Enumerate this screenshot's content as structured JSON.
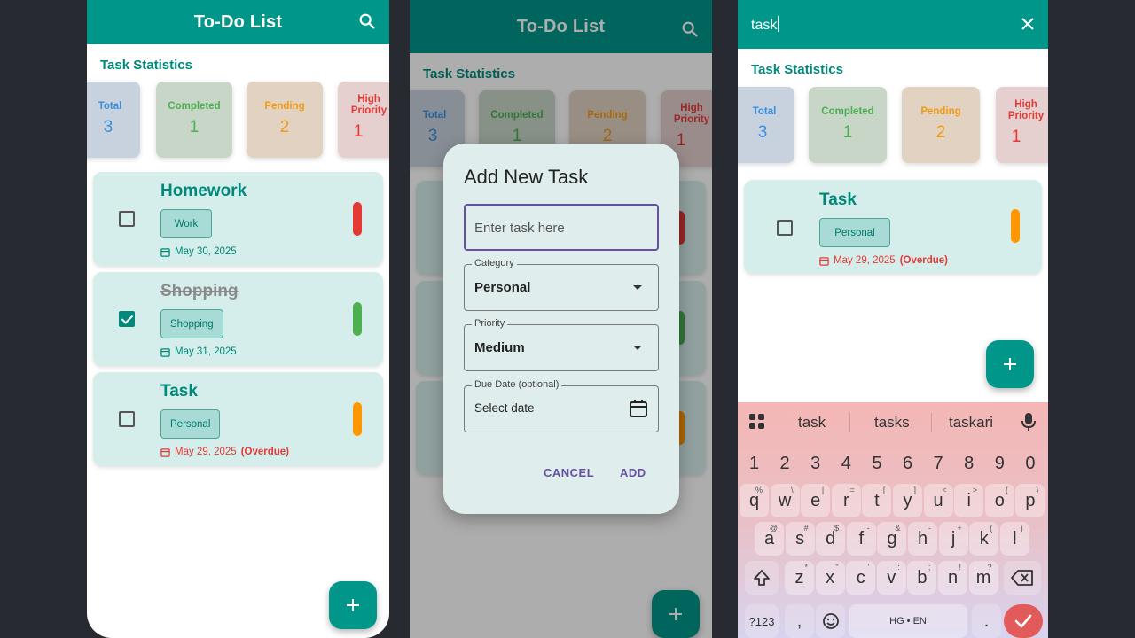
{
  "app": {
    "title": "To-Do List"
  },
  "stats": {
    "heading": "Task Statistics",
    "total_label": "Total",
    "total_value": "3",
    "completed_label": "Completed",
    "completed_value": "1",
    "pending_label": "Pending",
    "pending_value": "2",
    "high_label_1": "High",
    "high_label_2": "Priority",
    "high_value": "1"
  },
  "tasks": [
    {
      "title": "Homework",
      "category": "Work",
      "date": "May 30, 2025",
      "overdue": "",
      "checked": false,
      "priority_color": "#e53935"
    },
    {
      "title": "Shopping",
      "category": "Shopping",
      "date": "May 31, 2025",
      "overdue": "",
      "checked": true,
      "priority_color": "#4caf50"
    },
    {
      "title": "Task",
      "category": "Personal",
      "date": "May 29, 2025",
      "overdue": "(Overdue)",
      "checked": false,
      "priority_color": "#ff9800"
    }
  ],
  "dialog": {
    "title": "Add New Task",
    "task_placeholder": "Enter task here",
    "category_label": "Category",
    "category_value": "Personal",
    "priority_label": "Priority",
    "priority_value": "Medium",
    "due_label": "Due Date (optional)",
    "due_value": "Select date",
    "cancel": "CANCEL",
    "add": "ADD"
  },
  "search": {
    "query": "task",
    "result": {
      "title": "Task",
      "category": "Personal",
      "date": "May 29, 2025",
      "overdue": "(Overdue)",
      "priority_color": "#ff9800"
    }
  },
  "keyboard": {
    "suggestions": [
      "task",
      "tasks",
      "taskari"
    ],
    "numbers": [
      "1",
      "2",
      "3",
      "4",
      "5",
      "6",
      "7",
      "8",
      "9",
      "0"
    ],
    "row1": [
      "q",
      "w",
      "e",
      "r",
      "t",
      "y",
      "u",
      "i",
      "o",
      "p"
    ],
    "row1_sup": [
      "%",
      "\\",
      "|",
      "=",
      "[",
      "]",
      "<",
      ">",
      "{",
      "}"
    ],
    "row2": [
      "a",
      "s",
      "d",
      "f",
      "g",
      "h",
      "j",
      "k",
      "l"
    ],
    "row2_sup": [
      "@",
      "#",
      "$",
      "-",
      "&",
      "-",
      "+",
      "(",
      ")"
    ],
    "row3": [
      "z",
      "x",
      "c",
      "v",
      "b",
      "n",
      "m"
    ],
    "row3_sup": [
      "*",
      "\"",
      "'",
      ":",
      ";",
      "!",
      "?"
    ],
    "sym_label": "?123",
    "comma": ",",
    "space_label": "HG • EN",
    "period": "."
  },
  "colors": {
    "primary": "#00968a",
    "accent_purple": "#6750a4",
    "overdue": "#e53935"
  },
  "icons": [
    "search-icon",
    "calendar-icon",
    "close-icon",
    "plus-icon",
    "mic-icon",
    "apps-grid-icon",
    "backspace-icon",
    "shift-icon",
    "emoji-icon",
    "check-icon",
    "dropdown-arrow-icon"
  ]
}
